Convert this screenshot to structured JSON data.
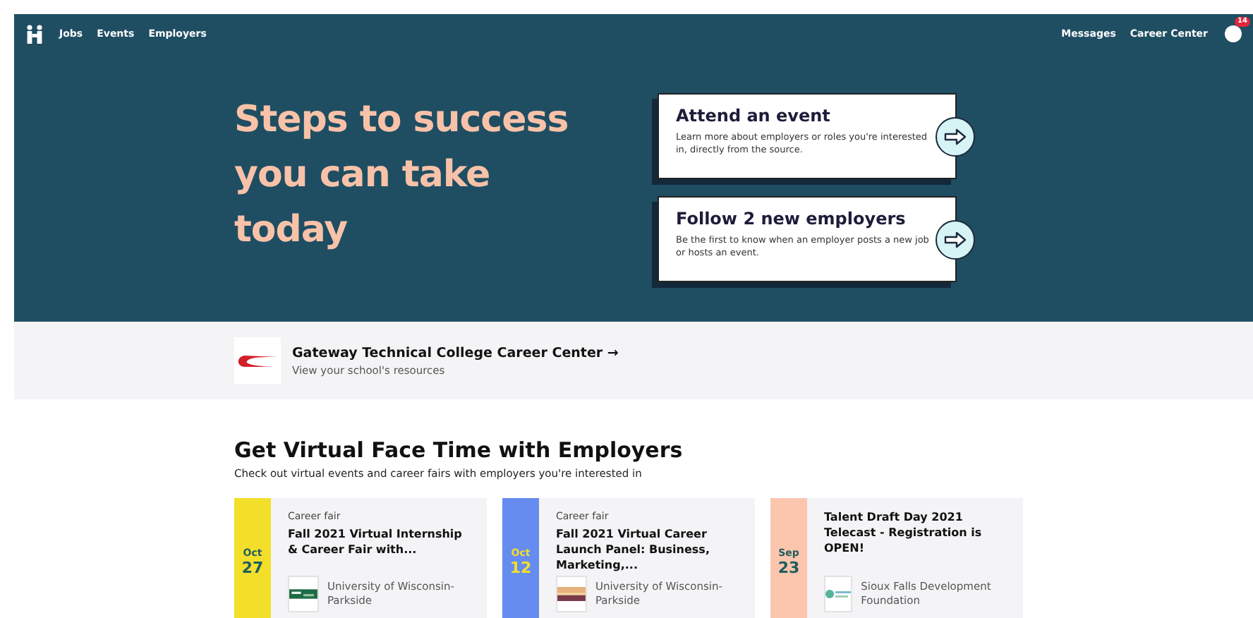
{
  "nav": {
    "left": [
      "Jobs",
      "Events",
      "Employers"
    ],
    "right": [
      "Messages",
      "Career Center"
    ],
    "badge": "14"
  },
  "hero": {
    "headline": "Steps to success you can take today",
    "cards": [
      {
        "title": "Attend an event",
        "text": "Learn more about employers or roles you're interested in, directly from the source."
      },
      {
        "title": "Follow 2 new employers",
        "text": "Be the first to know when an employer posts a new job or hosts an event."
      }
    ]
  },
  "school": {
    "title": "Gateway Technical College Career Center →",
    "subtitle": "View your school's resources"
  },
  "section": {
    "title": "Get Virtual Face Time with Employers",
    "subtitle": "Check out virtual events and career fairs with employers you're interested in"
  },
  "events": [
    {
      "month": "Oct",
      "day": "27",
      "color": "#f3df2a",
      "type": "Career fair",
      "title": "Fall 2021 Virtual Internship & Career Fair with...",
      "org": "University of Wisconsin-Parkside"
    },
    {
      "month": "Oct",
      "day": "12",
      "color": "#668cef",
      "type": "Career fair",
      "title": "Fall 2021 Virtual Career Launch Panel: Business, Marketing,...",
      "org": "University of Wisconsin-Parkside"
    },
    {
      "month": "Sep",
      "day": "23",
      "color": "#fcc5ae",
      "title": "Talent Draft Day 2021 Telecast - Registration is OPEN!",
      "org": "Sioux Falls Development Foundation"
    }
  ]
}
